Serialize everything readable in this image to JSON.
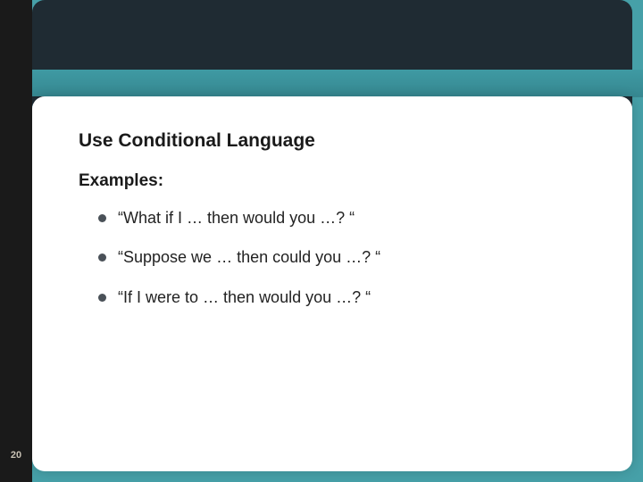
{
  "slide": {
    "number": "20",
    "title": "Use Conditional Language",
    "subtitle": "Examples:",
    "bullets": [
      "“What if I … then would you …? “",
      "“Suppose we … then could you …? “",
      "“If I were to … then would you …? “"
    ]
  }
}
